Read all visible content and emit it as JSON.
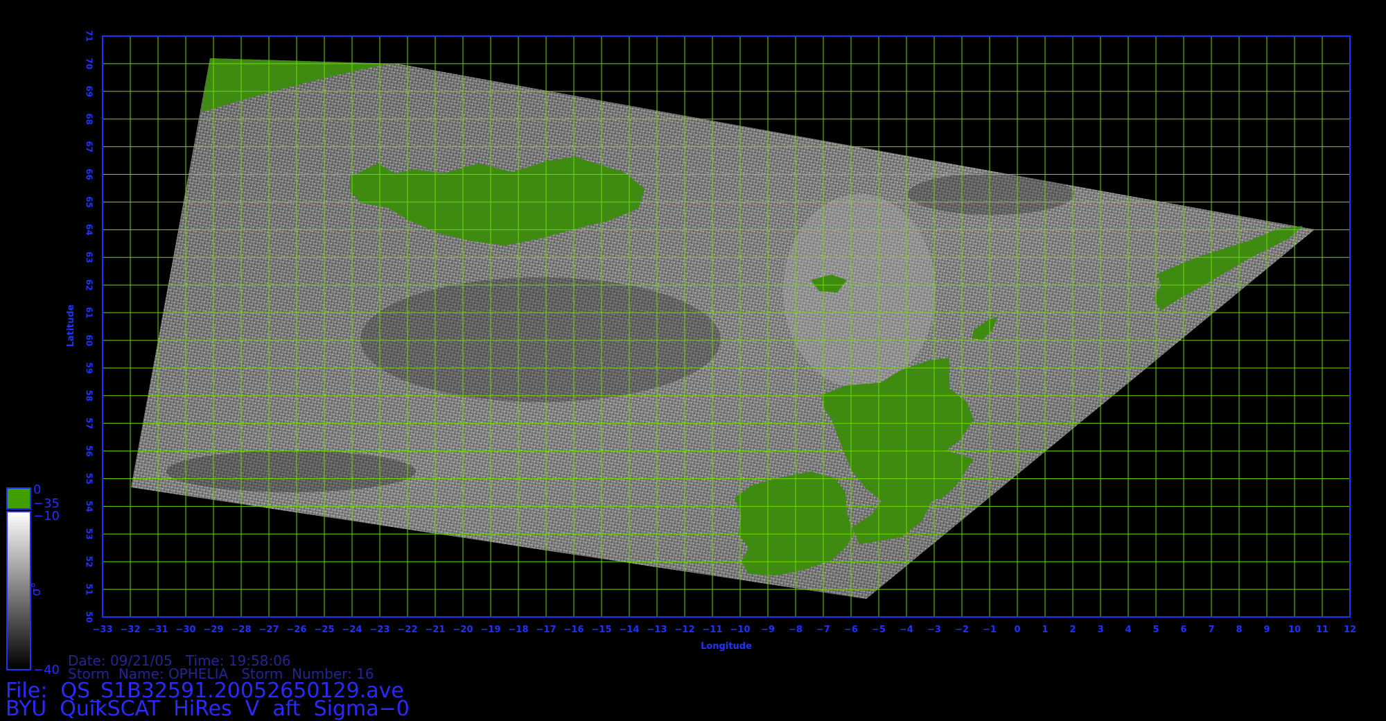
{
  "map": {
    "lon_range": [
      -33,
      12
    ],
    "lat_range": [
      50,
      71
    ],
    "lon_ticks": [
      "-33",
      "-32",
      "-31",
      "-30",
      "-29",
      "-28",
      "-27",
      "-26",
      "-25",
      "-24",
      "-23",
      "-22",
      "-21",
      "-20",
      "-19",
      "-18",
      "-17",
      "-16",
      "-15",
      "-14",
      "-13",
      "-12",
      "-11",
      "-10",
      "-9",
      "-8",
      "-7",
      "-6",
      "-5",
      "-4",
      "-3",
      "-2",
      "-1",
      "0",
      "1",
      "2",
      "3",
      "4",
      "5",
      "6",
      "7",
      "8",
      "9",
      "10",
      "11",
      "12"
    ],
    "lat_ticks": [
      "50",
      "51",
      "52",
      "53",
      "54",
      "55",
      "56",
      "57",
      "58",
      "59",
      "60",
      "61",
      "62",
      "63",
      "64",
      "65",
      "66",
      "67",
      "68",
      "69",
      "70",
      "71"
    ],
    "xlabel": "Longitude",
    "ylabel": "Latitude",
    "colors": {
      "frame": "#1f32ff",
      "grid": "#6fd800",
      "land": "#3f8a10",
      "background": "#000000"
    },
    "land_masses": [
      "Iceland",
      "Faroe Islands",
      "Shetland",
      "Ireland",
      "Great Britain",
      "Norway"
    ],
    "swath_corners_lonlat": [
      [
        -29,
        70.2
      ],
      [
        -22,
        70
      ],
      [
        11,
        64
      ],
      [
        -5.5,
        50.7
      ],
      [
        -32,
        54.7
      ]
    ]
  },
  "colorbar": {
    "unit_symbol": "σ°",
    "labels": [
      "0",
      "−35",
      "−10",
      "−40"
    ],
    "top_color": "#3fa000",
    "gradient": [
      "#ffffff",
      "#000000"
    ]
  },
  "info": {
    "date_line": "Date: 09/21/05   Time: 19:58:06",
    "storm_line": "Storm  Name: OPHELIA   Storm  Number: 16",
    "file_line": "File:  QS_S1B32591.20052650129.ave",
    "product_line": "BYU  QuikSCAT  HiRes  V  aft  Sigma−0"
  }
}
